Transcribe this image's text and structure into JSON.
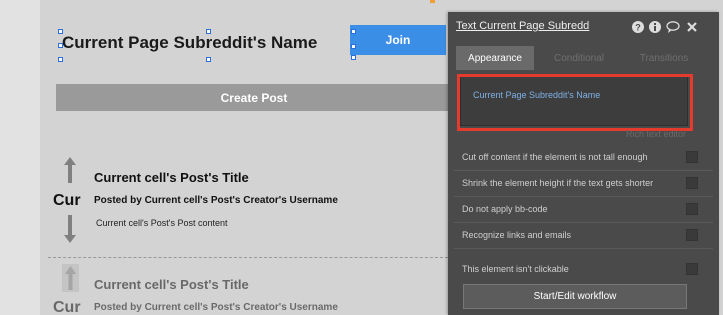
{
  "page": {
    "title": "Current Page Subreddit's Name",
    "join_label": "Join",
    "create_post_label": "Create Post"
  },
  "posts": [
    {
      "vote_label": "Cur",
      "title": "Current cell's Post's Title",
      "author": "Posted by Current cell's Post's Creator's Username",
      "content": "Current cell's Post's Post content"
    },
    {
      "vote_label": "Cur",
      "title": "Current cell's Post's Title",
      "author": "Posted by Current cell's Post's Creator's Username"
    }
  ],
  "panel": {
    "title": "Text Current Page Subredd",
    "tabs": [
      "Appearance",
      "Conditional",
      "Transitions"
    ],
    "active_tab": "Appearance",
    "text_value": "Current Page Subreddit's Name",
    "rich_text_label": "Rich text editor",
    "options": [
      "Cut off content if the element is not tall enough",
      "Shrink the element height if the text gets shorter",
      "Do not apply bb-code",
      "Recognize links and emails",
      "This element isn't clickable"
    ],
    "workflow_button": "Start/Edit workflow"
  },
  "colors": {
    "join_button": "#3b8ee6",
    "highlight": "#e53b2f",
    "panel_bg": "#4a4a4a",
    "dynamic_text": "#7fb0e6"
  },
  "icons": {
    "help": "question-circle-icon",
    "info": "info-circle-icon",
    "comment": "comment-icon",
    "close": "close-icon",
    "upvote": "arrow-up-icon",
    "downvote": "arrow-down-icon"
  }
}
